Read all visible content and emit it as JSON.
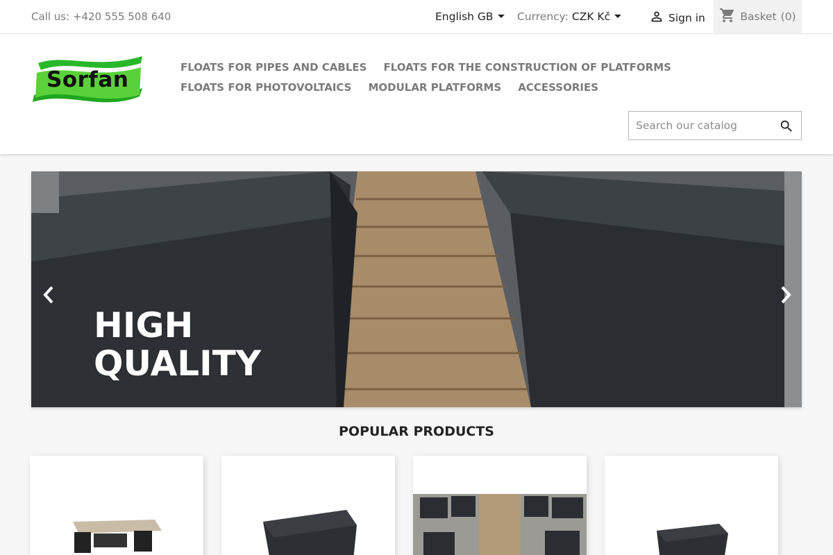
{
  "topbar": {
    "call_label": "Call us:",
    "phone": "+420 555 508 640",
    "language": "English GB",
    "currency_label": "Currency:",
    "currency_value": "CZK Kč",
    "signin": "Sign in",
    "basket_label": "Basket",
    "basket_count": "(0)"
  },
  "logo": {
    "text": "Sorfan",
    "color_green": "#2db82d"
  },
  "menu": {
    "items": [
      "Floats for pipes and cables",
      "Floats for the construction of platforms",
      "Floats for photovoltaics",
      "Modular platforms",
      "Accessories"
    ]
  },
  "search": {
    "placeholder": "Search our catalog"
  },
  "slider": {
    "caption_line1": "High",
    "caption_line2": "Quality"
  },
  "popular": {
    "title": "Popular Products"
  },
  "icons": {
    "user": "user-icon",
    "cart": "shopping-cart-icon",
    "search": "search-icon",
    "prev": "chevron-left-icon",
    "next": "chevron-right-icon"
  }
}
